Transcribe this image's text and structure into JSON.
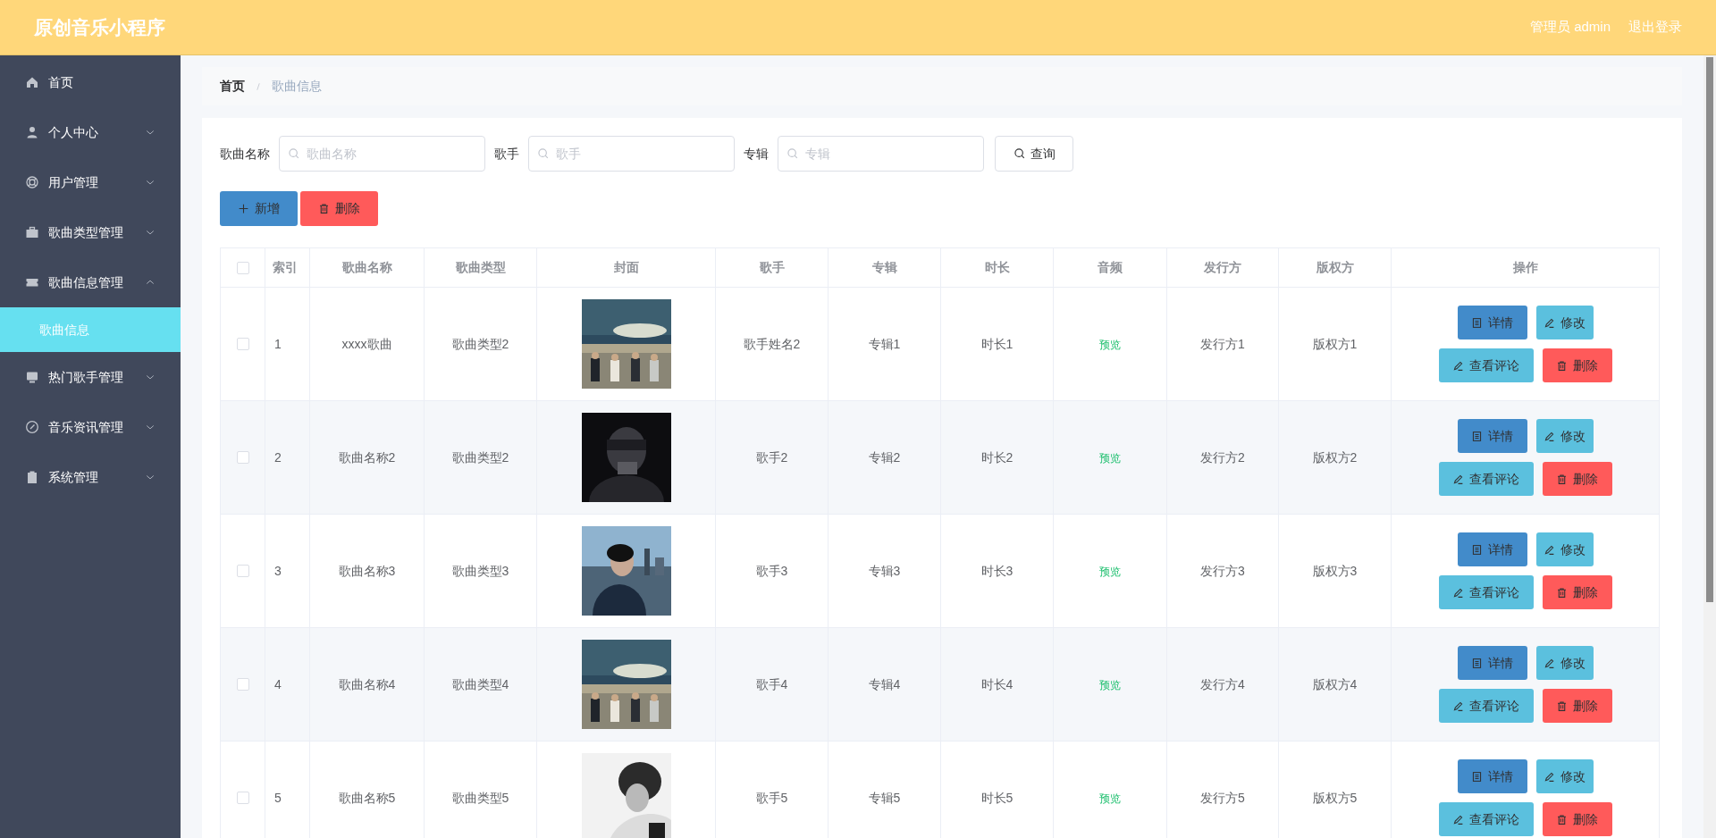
{
  "header": {
    "title": "原创音乐小程序",
    "user": "管理员 admin",
    "logout": "退出登录"
  },
  "sidebar": {
    "items": [
      {
        "label": "首页",
        "kind": "link",
        "selected": false
      },
      {
        "label": "个人中心",
        "kind": "group",
        "expanded": false,
        "selected": false
      },
      {
        "label": "用户管理",
        "kind": "group",
        "expanded": false,
        "selected": false
      },
      {
        "label": "歌曲类型管理",
        "kind": "group",
        "expanded": false,
        "selected": false
      },
      {
        "label": "歌曲信息管理",
        "kind": "group",
        "expanded": true,
        "selected": false,
        "children": [
          {
            "label": "歌曲信息",
            "selected": true
          }
        ]
      },
      {
        "label": "热门歌手管理",
        "kind": "group",
        "expanded": false,
        "selected": false
      },
      {
        "label": "音乐资讯管理",
        "kind": "group",
        "expanded": false,
        "selected": false
      },
      {
        "label": "系统管理",
        "kind": "group",
        "expanded": false,
        "selected": false
      }
    ]
  },
  "breadcrumb": [
    "首页",
    "歌曲信息"
  ],
  "search": {
    "fields": [
      {
        "label": "歌曲名称",
        "placeholder": "歌曲名称"
      },
      {
        "label": "歌手",
        "placeholder": "歌手"
      },
      {
        "label": "专辑",
        "placeholder": "专辑"
      }
    ],
    "button": "查询"
  },
  "toolbar": [
    {
      "label": "新增",
      "kind": "add"
    },
    {
      "label": "删除",
      "kind": "delete"
    }
  ],
  "table": {
    "select_all_checked": false,
    "columns": [
      "索引",
      "歌曲名称",
      "歌曲类型",
      "封面",
      "歌手",
      "专辑",
      "时长",
      "音频",
      "发行方",
      "版权方",
      "操作"
    ],
    "rows": [
      {
        "checked": false,
        "cells": [
          "1",
          "xxxx歌曲",
          "歌曲类型2",
          {
            "kind": "picture"
          },
          "歌手姓名2",
          "专辑1",
          "时长1",
          "预览",
          "发行方1",
          "版权方1"
        ],
        "actions": [
          "详情",
          "修改",
          "查看评论",
          "删除"
        ]
      },
      {
        "checked": false,
        "cells": [
          "2",
          "歌曲名称2",
          "歌曲类型2",
          {
            "kind": "picture"
          },
          "歌手2",
          "专辑2",
          "时长2",
          "预览",
          "发行方2",
          "版权方2"
        ],
        "actions": [
          "详情",
          "修改",
          "查看评论",
          "删除"
        ]
      },
      {
        "checked": false,
        "cells": [
          "3",
          "歌曲名称3",
          "歌曲类型3",
          {
            "kind": "picture"
          },
          "歌手3",
          "专辑3",
          "时长3",
          "预览",
          "发行方3",
          "版权方3"
        ],
        "actions": [
          "详情",
          "修改",
          "查看评论",
          "删除"
        ]
      },
      {
        "checked": false,
        "cells": [
          "4",
          "歌曲名称4",
          "歌曲类型4",
          {
            "kind": "picture"
          },
          "歌手4",
          "专辑4",
          "时长4",
          "预览",
          "发行方4",
          "版权方4"
        ],
        "actions": [
          "详情",
          "修改",
          "查看评论",
          "删除"
        ]
      },
      {
        "checked": false,
        "cells": [
          "5",
          "歌曲名称5",
          "歌曲类型5",
          {
            "kind": "picture"
          },
          "歌手5",
          "专辑5",
          "时长5",
          "预览",
          "发行方5",
          "版权方5"
        ],
        "actions": [
          "详情",
          "修改",
          "查看评论",
          "删除"
        ]
      }
    ]
  }
}
